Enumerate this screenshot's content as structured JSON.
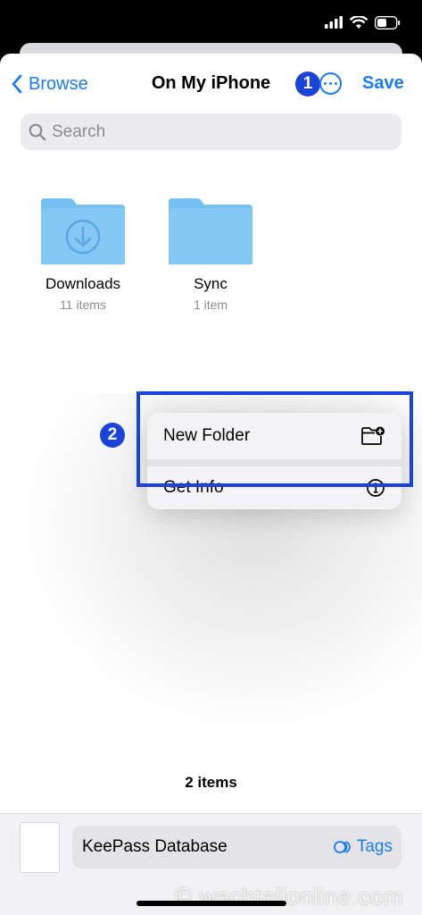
{
  "nav": {
    "back_label": "Browse",
    "title": "On My iPhone",
    "save_label": "Save"
  },
  "search": {
    "placeholder": "Search"
  },
  "folders": [
    {
      "name": "Downloads",
      "count": "11 items",
      "icon": "download-folder-icon"
    },
    {
      "name": "Sync",
      "count": "1 item",
      "icon": "folder-icon"
    }
  ],
  "annotations": {
    "badge1": "1",
    "badge2": "2"
  },
  "context_menu": {
    "items": [
      {
        "label": "New Folder",
        "icon": "new-folder-icon"
      },
      {
        "label": "Get Info",
        "icon": "info-icon"
      }
    ]
  },
  "footer": {
    "items_count": "2 items",
    "file_name": "KeePass Database",
    "tags_label": "Tags"
  },
  "watermark": "© wachtellonline.com",
  "colors": {
    "accent": "#1a7cf4",
    "annotation": "#1a44d8",
    "folder": "#7cc4f3"
  }
}
